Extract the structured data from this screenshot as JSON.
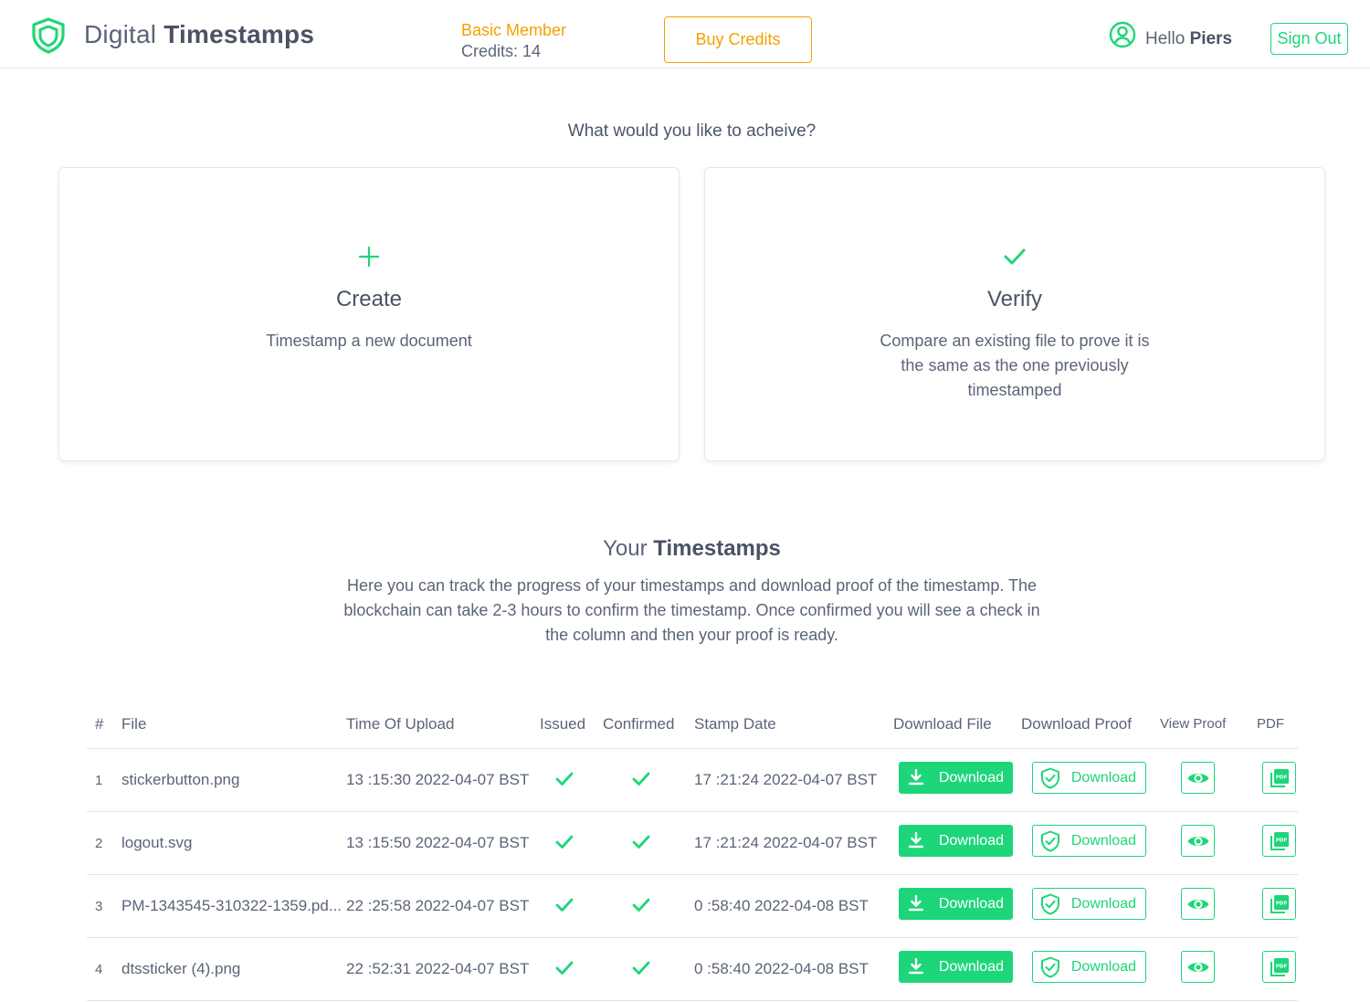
{
  "header": {
    "brand_light": "Digital",
    "brand_bold": "Timestamps",
    "member_level": "Basic Member",
    "credits": "Credits: 14",
    "buy_credits": "Buy Credits",
    "hello": "Hello",
    "user_name": "Piers",
    "sign_out": "Sign Out"
  },
  "achieve": {
    "question": "What would you like to acheive?",
    "create": {
      "title": "Create",
      "description": "Timestamp a new document"
    },
    "verify": {
      "title": "Verify",
      "description": "Compare an existing file to prove it is the same as the one previously timestamped"
    }
  },
  "timestamps": {
    "title_light": "Your",
    "title_bold": "Timestamps",
    "description": "Here you can track the progress of your timestamps and download proof of the timestamp. The blockchain can take 2-3 hours to confirm the timestamp. Once confirmed you will see a check in the column and then your proof is ready.",
    "columns": [
      "#",
      "File",
      "Time Of Upload",
      "Issued",
      "Confirmed",
      "Stamp Date",
      "Download File",
      "Download Proof",
      "View Proof",
      "PDF"
    ],
    "rows": [
      {
        "num": "1",
        "file": "stickerbutton.png",
        "upload": "13 :15:30 2022-04-07 BST",
        "issued": true,
        "confirmed": true,
        "stamp": "17 :21:24 2022-04-07 BST",
        "download_file": "Download",
        "download_proof": "Download"
      },
      {
        "num": "2",
        "file": "logout.svg",
        "upload": "13 :15:50 2022-04-07 BST",
        "issued": true,
        "confirmed": true,
        "stamp": "17 :21:24 2022-04-07 BST",
        "download_file": "Download",
        "download_proof": "Download"
      },
      {
        "num": "3",
        "file": "PM-1343545-310322-1359.pd...",
        "upload": "22 :25:58 2022-04-07 BST",
        "issued": true,
        "confirmed": true,
        "stamp": "0 :58:40 2022-04-08 BST",
        "download_file": "Download",
        "download_proof": "Download"
      },
      {
        "num": "4",
        "file": "dtssticker (4).png",
        "upload": "22 :52:31 2022-04-07 BST",
        "issued": true,
        "confirmed": true,
        "stamp": "0 :58:40 2022-04-08 BST",
        "download_file": "Download",
        "download_proof": "Download"
      }
    ]
  },
  "icons": {
    "logo": "shield-icon",
    "user": "user-circle-icon",
    "create": "plus-icon",
    "verify": "check-icon",
    "download": "download-arrow-icon",
    "proof": "shield-check-icon",
    "view": "eye-icon",
    "pdf": "pdf-icon"
  },
  "colors": {
    "accent_green": "#1dd679",
    "accent_orange": "#f5a000",
    "text": "#5a6478"
  }
}
